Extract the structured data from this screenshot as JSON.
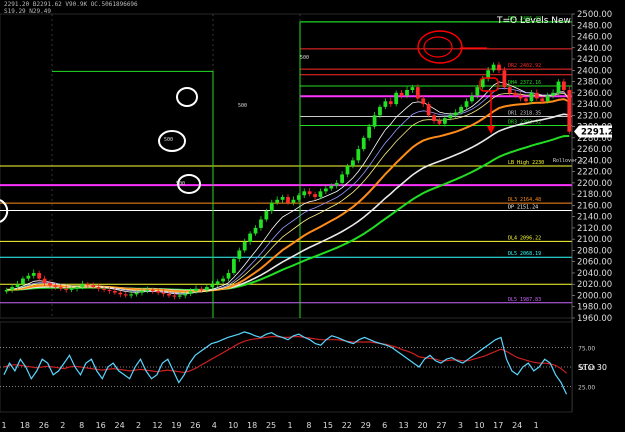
{
  "header": {
    "quote_line": "2291.20 B2291.62 V90.9K OC.5061896696",
    "sub_line": "S19.29 N29.49"
  },
  "title": "T=O Levels New",
  "colors": {
    "bg": "#000000",
    "candle_up": "#22e022",
    "candle_down": "#ff2a2a",
    "ema_orange": "#ff8c1a",
    "ema_white": "#e8e8e8",
    "ema_green": "#22dd22",
    "magenta_line": "#ff33ff",
    "yellow_line": "#ffff33",
    "cyan_line": "#33ffff",
    "annotation": "#ff0000",
    "stoch_k": "#5ad6ff",
    "stoch_d": "#cc1f1f"
  },
  "chart_data": [
    {
      "type": "candlestick",
      "ylim": [
        1960,
        2500
      ],
      "yticks": [
        1960,
        1980,
        2000,
        2020,
        2040,
        2060,
        2080,
        2100,
        2120,
        2140,
        2160,
        2180,
        2200,
        2220,
        2240,
        2260,
        2280,
        2300,
        2320,
        2340,
        2360,
        2380,
        2400,
        2420,
        2440,
        2460,
        2480,
        2500
      ],
      "x_tick_labels": [
        "1",
        "18",
        "26",
        "2",
        "8",
        "16",
        "24",
        "2",
        "12",
        "19",
        "26",
        "4",
        "10",
        "18",
        "25",
        "1",
        "8",
        "15",
        "22",
        "29",
        "6",
        "13",
        "20",
        "27",
        "3",
        "10",
        "17",
        "24",
        "1"
      ],
      "last_price_label": "2291.20",
      "closes": [
        2010,
        2015,
        2020,
        2030,
        2035,
        2040,
        2030,
        2022,
        2018,
        2015,
        2012,
        2010,
        2012,
        2015,
        2020,
        2018,
        2015,
        2012,
        2010,
        2008,
        2005,
        2002,
        2000,
        2002,
        2005,
        2008,
        2010,
        2008,
        2005,
        2003,
        2000,
        1998,
        2000,
        2003,
        2008,
        2012,
        2010,
        2015,
        2020,
        2025,
        2030,
        2040,
        2065,
        2080,
        2095,
        2110,
        2120,
        2135,
        2150,
        2165,
        2170,
        2175,
        2165,
        2170,
        2178,
        2185,
        2180,
        2175,
        2185,
        2190,
        2195,
        2200,
        2215,
        2230,
        2240,
        2260,
        2280,
        2300,
        2320,
        2335,
        2345,
        2340,
        2360,
        2355,
        2365,
        2370,
        2350,
        2340,
        2320,
        2310,
        2305,
        2315,
        2320,
        2325,
        2335,
        2345,
        2355,
        2370,
        2385,
        2400,
        2410,
        2400,
        2370,
        2360,
        2355,
        2350,
        2345,
        2360,
        2350,
        2345,
        2355,
        2360,
        2380,
        2365,
        2291
      ],
      "levels": [
        {
          "label": "DR5 2486.49",
          "value": 2486,
          "color": "#22dd22"
        },
        {
          "label": "",
          "value": 2438,
          "color": "#ff2a2a"
        },
        {
          "label": "DR2 2402.92",
          "value": 2402,
          "color": "#ff2a2a"
        },
        {
          "label": "",
          "value": 2392,
          "color": "#ff2a2a"
        },
        {
          "label": "DH4 2372.16",
          "value": 2372,
          "color": "#22dd22"
        },
        {
          "label": "",
          "value": 2354,
          "color": "#ff33ff"
        },
        {
          "label": "DR1 2318.35",
          "value": 2318,
          "color": "#cccccc"
        },
        {
          "label": "DR3 2302.92",
          "value": 2302,
          "color": "#22dd22"
        },
        {
          "label": "LB High 2230",
          "value": 2230,
          "color": "#ffff33"
        },
        {
          "label": "",
          "value": 2196,
          "color": "#ff33ff"
        },
        {
          "label": "DL3 2164.48",
          "value": 2164,
          "color": "#ff8c1a"
        },
        {
          "label": "DP 2151.24",
          "value": 2151,
          "color": "#ffffff"
        },
        {
          "label": "DL4 2096.22",
          "value": 2096,
          "color": "#ffff33"
        },
        {
          "label": "DL5 2068.19",
          "value": 2068,
          "color": "#33ffff"
        },
        {
          "label": "",
          "value": 2020,
          "color": "#ffff33"
        },
        {
          "label": "DL5 1987.83",
          "value": 1987,
          "color": "#cc66ff"
        }
      ],
      "annotations": [
        "500",
        "500",
        "500",
        "500",
        "Rollover 2"
      ]
    },
    {
      "type": "line",
      "title": "STO 30",
      "ylim": [
        0,
        100
      ],
      "yticks": [
        25,
        50,
        75
      ],
      "series_k": [
        40,
        55,
        45,
        60,
        50,
        35,
        45,
        60,
        55,
        40,
        45,
        55,
        65,
        50,
        40,
        55,
        60,
        45,
        35,
        50,
        55,
        45,
        40,
        35,
        50,
        60,
        45,
        35,
        40,
        55,
        60,
        45,
        30,
        40,
        55,
        65,
        70,
        75,
        80,
        82,
        85,
        88,
        90,
        92,
        95,
        93,
        90,
        88,
        92,
        94,
        90,
        88,
        85,
        90,
        92,
        88,
        85,
        80,
        78,
        85,
        90,
        88,
        85,
        82,
        80,
        85,
        88,
        85,
        82,
        80,
        78,
        75,
        70,
        65,
        60,
        55,
        50,
        60,
        65,
        58,
        55,
        60,
        62,
        58,
        55,
        60,
        65,
        70,
        75,
        80,
        85,
        88,
        60,
        45,
        40,
        50,
        55,
        45,
        50,
        60,
        55,
        40,
        30,
        15
      ],
      "series_d": [
        50,
        52,
        53,
        52,
        51,
        50,
        49,
        50,
        51,
        50,
        49,
        48,
        50,
        51,
        50,
        49,
        48,
        47,
        46,
        47,
        48,
        47,
        46,
        45,
        46,
        47,
        46,
        45,
        44,
        45,
        46,
        45,
        44,
        43,
        45,
        48,
        52,
        56,
        60,
        64,
        68,
        72,
        76,
        80,
        83,
        85,
        86,
        87,
        88,
        89,
        89,
        88,
        88,
        89,
        89,
        88,
        87,
        86,
        85,
        85,
        85,
        85,
        84,
        83,
        82,
        82,
        82,
        82,
        81,
        80,
        79,
        77,
        75,
        72,
        70,
        67,
        63,
        62,
        61,
        60,
        58,
        58,
        59,
        59,
        58,
        58,
        60,
        62,
        64,
        67,
        70,
        73,
        70,
        66,
        62,
        60,
        58,
        56,
        55,
        55,
        54,
        52,
        48,
        42
      ]
    }
  ]
}
